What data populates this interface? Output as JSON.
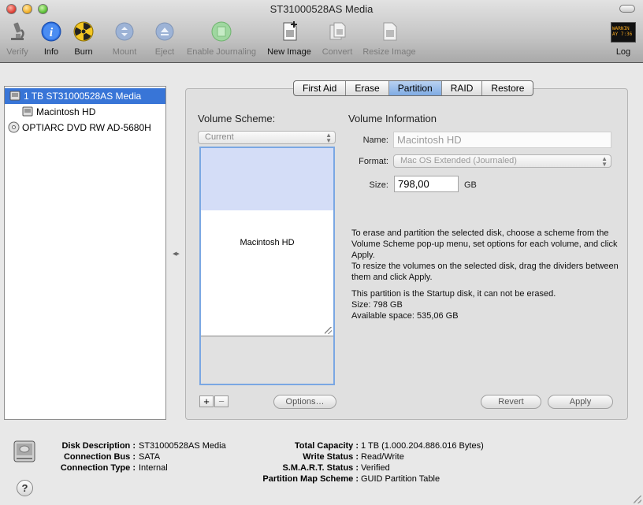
{
  "window": {
    "title": "ST31000528AS Media"
  },
  "toolbar": {
    "verify": "Verify",
    "info": "Info",
    "burn": "Burn",
    "mount": "Mount",
    "eject": "Eject",
    "enable_journaling": "Enable Journaling",
    "new_image": "New Image",
    "convert": "Convert",
    "resize_image": "Resize Image",
    "log": "Log",
    "log_badge": "WARNIN\nAY 7:36"
  },
  "sidebar": {
    "items": [
      {
        "label": "1 TB ST31000528AS Media",
        "icon": "hard-disk-icon",
        "selected": true
      },
      {
        "label": "Macintosh HD",
        "icon": "volume-icon",
        "selected": false
      },
      {
        "label": "OPTIARC DVD RW AD-5680H",
        "icon": "optical-drive-icon",
        "selected": false
      }
    ]
  },
  "tabs": [
    "First Aid",
    "Erase",
    "Partition",
    "RAID",
    "Restore"
  ],
  "active_tab": "Partition",
  "partition": {
    "volume_scheme_label": "Volume Scheme:",
    "volume_scheme_value": "Current",
    "partition_name": "Macintosh HD",
    "add_label": "+",
    "remove_label": "−",
    "options_label": "Options…",
    "revert_label": "Revert",
    "apply_label": "Apply"
  },
  "volume_info": {
    "heading": "Volume Information",
    "name_label": "Name:",
    "name_value": "Macintosh HD",
    "format_label": "Format:",
    "format_value": "Mac OS Extended (Journaled)",
    "size_label": "Size:",
    "size_value": "798,00",
    "size_unit": "GB"
  },
  "instructions": {
    "line1": "To erase and partition the selected disk, choose a scheme from the Volume Scheme pop-up menu, set options for each volume, and click Apply.",
    "line2": "To resize the volumes on the selected disk, drag the dividers between them and click Apply.",
    "startup_note": "This partition is the Startup disk, it can not be erased.",
    "size_note": "Size: 798 GB",
    "available_note": "Available space: 535,06 GB"
  },
  "disk_info": {
    "description_label": "Disk Description :",
    "description_value": "ST31000528AS Media",
    "bus_label": "Connection Bus :",
    "bus_value": "SATA",
    "type_label": "Connection Type :",
    "type_value": "Internal",
    "capacity_label": "Total Capacity :",
    "capacity_value": "1 TB (1.000.204.886.016 Bytes)",
    "write_label": "Write Status :",
    "write_value": "Read/Write",
    "smart_label": "S.M.A.R.T. Status :",
    "smart_value": "Verified",
    "pms_label": "Partition Map Scheme :",
    "pms_value": "GUID Partition Table"
  },
  "help": "?"
}
